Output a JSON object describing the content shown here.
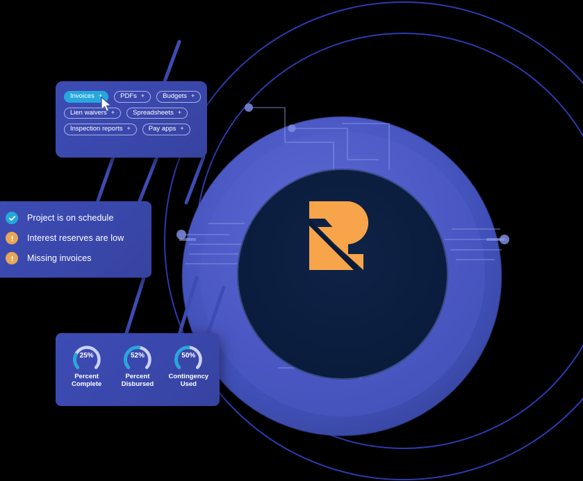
{
  "brand": {
    "logo_name": "R-monogram",
    "logo_color": "#F7A44A",
    "core_color": "#0B1D3E",
    "orb_color": "#4B58C4",
    "ring_outline_color": "#2C3BB0",
    "accent_cyan": "#26A8DD",
    "accent_warn": "#E8A757",
    "panel_color": "#3A48AD"
  },
  "doc_types_panel": {
    "name": "document-types",
    "chips": [
      {
        "label": "Invoices",
        "plus": "+",
        "active": true
      },
      {
        "label": "PDFs",
        "plus": "+",
        "active": false
      },
      {
        "label": "Budgets",
        "plus": "+",
        "active": false
      },
      {
        "label": "Lien waivers",
        "plus": "+",
        "active": false
      },
      {
        "label": "Spreadsheets",
        "plus": "+",
        "active": false
      },
      {
        "label": "Inspection reports",
        "plus": "+",
        "active": false
      },
      {
        "label": "Pay apps",
        "plus": "+",
        "active": false
      }
    ],
    "cursor_icon": "mouse-pointer-icon"
  },
  "status_panel": {
    "name": "project-status",
    "items": [
      {
        "text": "Project is on schedule",
        "state": "ok",
        "icon": "check-circle-icon"
      },
      {
        "text": "Interest reserves are low",
        "state": "warn",
        "icon": "alert-circle-icon"
      },
      {
        "text": "Missing invoices",
        "state": "warn",
        "icon": "alert-circle-icon"
      }
    ]
  },
  "metrics_panel": {
    "name": "project-metrics",
    "gauges": [
      {
        "value": "25%",
        "percent": 25,
        "label_line1": "Percent",
        "label_line2": "Complete"
      },
      {
        "value": "52%",
        "percent": 52,
        "label_line1": "Percent",
        "label_line2": "Disbursed"
      },
      {
        "value": "50%",
        "percent": 50,
        "label_line1": "Contingency",
        "label_line2": "Used"
      }
    ]
  }
}
